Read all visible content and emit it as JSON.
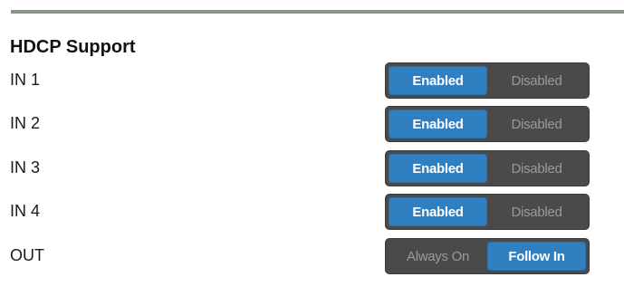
{
  "section": {
    "title": "HDCP Support"
  },
  "rows": [
    {
      "label": "IN 1",
      "options": [
        "Enabled",
        "Disabled"
      ],
      "selected": "Enabled"
    },
    {
      "label": "IN 2",
      "options": [
        "Enabled",
        "Disabled"
      ],
      "selected": "Enabled"
    },
    {
      "label": "IN 3",
      "options": [
        "Enabled",
        "Disabled"
      ],
      "selected": "Enabled"
    },
    {
      "label": "IN 4",
      "options": [
        "Enabled",
        "Disabled"
      ],
      "selected": "Enabled"
    },
    {
      "label": "OUT",
      "options": [
        "Always On",
        "Follow In"
      ],
      "selected": "Follow In"
    }
  ],
  "colors": {
    "accent": "#2f7fc1",
    "toggle_bg": "#4a4a4a",
    "divider": "#8a9489"
  }
}
